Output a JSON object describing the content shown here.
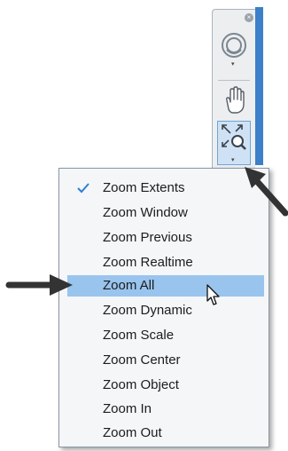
{
  "toolbar": {
    "close_glyph": "×",
    "buttons": [
      {
        "name": "steering-wheel",
        "icon": "steering-wheel-icon"
      },
      {
        "name": "pan",
        "icon": "hand-pan-icon"
      },
      {
        "name": "zoom",
        "icon": "zoom-extents-icon",
        "active": true
      }
    ],
    "colors": {
      "panel": "#eceef0",
      "edge": "#3b80c9",
      "active_button": "#cfe2f5"
    }
  },
  "zoom_menu": {
    "checked_item": "Zoom Extents",
    "hovered_item": "Zoom All",
    "items": [
      "Zoom Extents",
      "Zoom Window",
      "Zoom Previous",
      "Zoom Realtime",
      "Zoom All",
      "Zoom Dynamic",
      "Zoom Scale",
      "Zoom Center",
      "Zoom Object",
      "Zoom In",
      "Zoom Out"
    ],
    "colors": {
      "hover": "#99c4ee",
      "check": "#2f7fd3"
    }
  },
  "annotations": {
    "arrows": [
      "pointer-arrow-to-zoom-button",
      "pointer-arrow-to-zoom-all"
    ]
  }
}
